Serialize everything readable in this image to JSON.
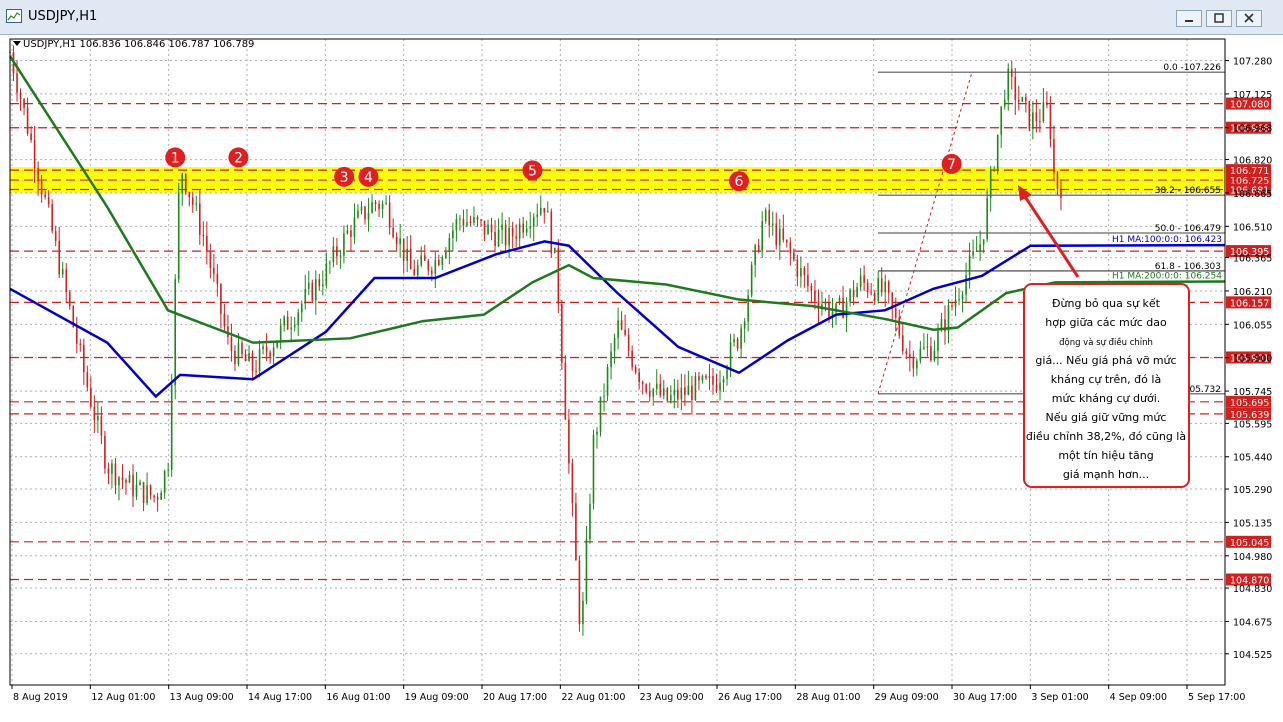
{
  "window": {
    "title": "USDJPY,H1",
    "buttons": [
      "minimize-button",
      "maximize-button",
      "close-button"
    ]
  },
  "chart_data": {
    "type": "candlestick",
    "info_line": "USDJPY,H1  106.836 106.846 106.787 106.789",
    "y_range": [
      104.38,
      107.38
    ],
    "price_ticks": [
      "107.280",
      "107.125",
      "106.968",
      "106.820",
      "106.665",
      "106.510",
      "106.365",
      "106.210",
      "106.055",
      "105.900",
      "105.745",
      "105.595",
      "105.440",
      "105.290",
      "105.135",
      "104.980",
      "104.830",
      "104.675",
      "104.525",
      "104.370"
    ],
    "x_ticks": [
      "8 Aug 2019",
      "12 Aug 01:00",
      "13 Aug 09:00",
      "14 Aug 17:00",
      "16 Aug 01:00",
      "19 Aug 09:00",
      "20 Aug 17:00",
      "22 Aug 01:00",
      "23 Aug 09:00",
      "26 Aug 17:00",
      "28 Aug 01:00",
      "29 Aug 09:00",
      "30 Aug 17:00",
      "3 Sep 01:00",
      "4 Sep 09:00",
      "5 Sep 17:00"
    ],
    "horizontal_levels": [
      {
        "price": 107.08,
        "label": "107.080"
      },
      {
        "price": 106.968,
        "label": "106.968"
      },
      {
        "price": 106.771,
        "label": "106.771"
      },
      {
        "price": 106.725,
        "label": "106.725"
      },
      {
        "price": 106.681,
        "label": "106.681"
      },
      {
        "price": 106.395,
        "label": "106.395"
      },
      {
        "price": 106.157,
        "label": "106.157"
      },
      {
        "price": 105.901,
        "label": "105.901"
      },
      {
        "price": 105.695,
        "label": "105.695"
      },
      {
        "price": 105.639,
        "label": "105.639"
      },
      {
        "price": 105.045,
        "label": "105.045"
      },
      {
        "price": 104.87,
        "label": "104.870"
      }
    ],
    "resistance_zone": [
      106.681,
      106.771
    ],
    "fibonacci": [
      {
        "label": "0.0 -107.226",
        "price": 107.226
      },
      {
        "label": "38.2 - 106.655",
        "price": 106.655
      },
      {
        "label": "50.0 - 106.479",
        "price": 106.479
      },
      {
        "label": "61.8 - 106.303",
        "price": 106.303
      },
      {
        "label": "105.732",
        "price": 105.732
      }
    ],
    "moving_averages": [
      {
        "name": "H1 MA:100:0:0: 106.423",
        "color": "#0000cc",
        "points": [
          [
            0,
            106.22
          ],
          [
            0.08,
            105.97
          ],
          [
            0.12,
            105.72
          ],
          [
            0.14,
            105.82
          ],
          [
            0.2,
            105.8
          ],
          [
            0.26,
            106.02
          ],
          [
            0.3,
            106.27
          ],
          [
            0.35,
            106.27
          ],
          [
            0.4,
            106.38
          ],
          [
            0.44,
            106.44
          ],
          [
            0.46,
            106.42
          ],
          [
            0.5,
            106.2
          ],
          [
            0.55,
            105.95
          ],
          [
            0.6,
            105.83
          ],
          [
            0.64,
            105.98
          ],
          [
            0.68,
            106.1
          ],
          [
            0.72,
            106.12
          ],
          [
            0.76,
            106.22
          ],
          [
            0.8,
            106.28
          ],
          [
            0.84,
            106.42
          ],
          [
            1,
            106.423
          ]
        ]
      },
      {
        "name": "H1 MA:200:0:0: 106.254",
        "color": "#1f7a1f",
        "points": [
          [
            0,
            107.3
          ],
          [
            0.08,
            106.6
          ],
          [
            0.13,
            106.12
          ],
          [
            0.2,
            105.97
          ],
          [
            0.28,
            105.99
          ],
          [
            0.34,
            106.07
          ],
          [
            0.39,
            106.1
          ],
          [
            0.43,
            106.25
          ],
          [
            0.46,
            106.33
          ],
          [
            0.48,
            106.27
          ],
          [
            0.54,
            106.24
          ],
          [
            0.6,
            106.17
          ],
          [
            0.66,
            106.14
          ],
          [
            0.72,
            106.08
          ],
          [
            0.76,
            106.03
          ],
          [
            0.78,
            106.04
          ],
          [
            0.82,
            106.2
          ],
          [
            0.86,
            106.25
          ],
          [
            1,
            106.254
          ]
        ]
      }
    ],
    "numbered_markers": [
      "1",
      "2",
      "3",
      "4",
      "5",
      "6",
      "7"
    ],
    "annotation": {
      "lines": [
        "Đừng bỏ qua sự kết",
        "hợp giữa các mức dao",
        "động và sự điều chỉnh",
        "giá... Nếu giá phá vỡ mức",
        "kháng cự trên, đó là",
        "mức kháng cự dưới.",
        "Nếu giá giữ vững mức",
        "điều chỉnh 38,2%, đó cũng là",
        "một tín hiệu tăng",
        "giá mạnh hơn..."
      ],
      "border_color": "#e02020"
    },
    "colors": {
      "bull": "#1a8a1a",
      "bear": "#d02020",
      "level": "#d02020",
      "zone": "#ffff00",
      "marker": "#e02020"
    }
  }
}
